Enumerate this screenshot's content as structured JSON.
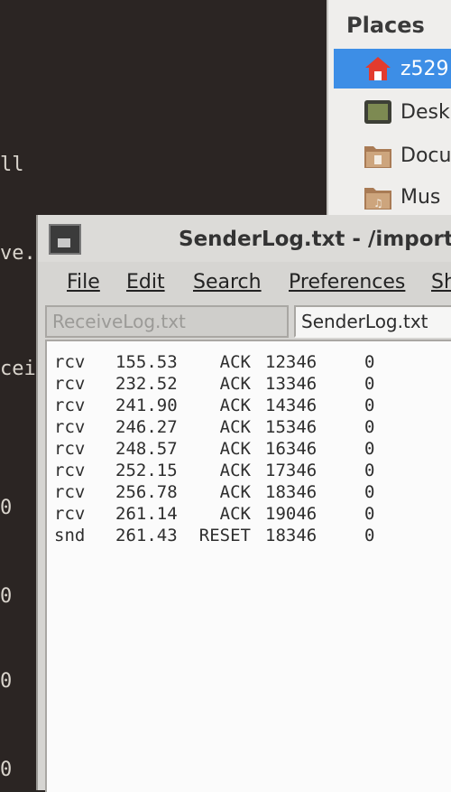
{
  "terminal": {
    "lines": [
      "ll",
      "ve.",
      "cei",
      "0",
      "0",
      "0",
      "0"
    ]
  },
  "places": {
    "title": "Places",
    "items": [
      {
        "label": "z529",
        "icon": "home-icon",
        "selected": true
      },
      {
        "label": "Desk",
        "icon": "desktop-icon",
        "selected": false
      },
      {
        "label": "Docu",
        "icon": "documents-folder-icon",
        "selected": false
      },
      {
        "label": "Mus",
        "icon": "music-folder-icon",
        "selected": false
      }
    ]
  },
  "editor": {
    "title": "SenderLog.txt - /import/",
    "menu": [
      "File",
      "Edit",
      "Search",
      "Preferences",
      "Sh"
    ],
    "tabs": {
      "receive": "ReceiveLog.txt",
      "sender": "SenderLog.txt"
    },
    "log_rows": [
      [
        "rcv",
        "155.53",
        "ACK",
        "12346",
        "0"
      ],
      [
        "rcv",
        "232.52",
        "ACK",
        "13346",
        "0"
      ],
      [
        "rcv",
        "241.90",
        "ACK",
        "14346",
        "0"
      ],
      [
        "rcv",
        "246.27",
        "ACK",
        "15346",
        "0"
      ],
      [
        "rcv",
        "248.57",
        "ACK",
        "16346",
        "0"
      ],
      [
        "rcv",
        "252.15",
        "ACK",
        "17346",
        "0"
      ],
      [
        "rcv",
        "256.78",
        "ACK",
        "18346",
        "0"
      ],
      [
        "rcv",
        "261.14",
        "ACK",
        "19046",
        "0"
      ],
      [
        "snd",
        "261.43",
        "RESET",
        "18346",
        "0"
      ]
    ]
  },
  "colors": {
    "selection": "#3d8ee6",
    "terminal_bg": "#2b2523"
  }
}
